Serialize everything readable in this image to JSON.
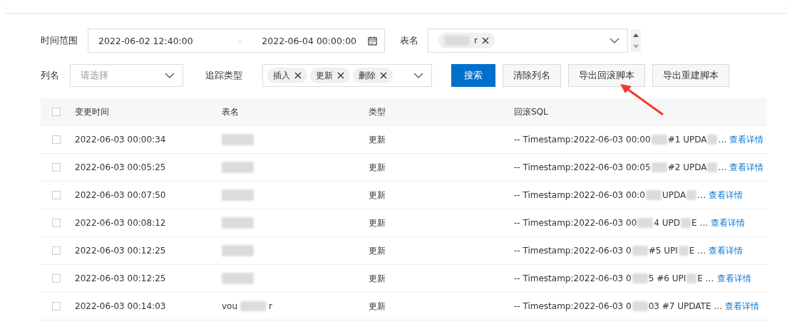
{
  "filters": {
    "time_range": {
      "label": "时间范围",
      "start": "2022-06-02 12:40:00",
      "separator": "-",
      "end": "2022-06-04 00:00:00"
    },
    "table_name": {
      "label": "表名",
      "tags": [
        {
          "text": "r"
        }
      ]
    },
    "column_name": {
      "label": "列名",
      "placeholder": "请选择"
    },
    "track_type": {
      "label": "追踪类型",
      "tags": [
        {
          "text": "插入"
        },
        {
          "text": "更新"
        },
        {
          "text": "删除"
        }
      ]
    }
  },
  "buttons": [
    {
      "label": "搜索",
      "kind": "primary"
    },
    {
      "label": "清除列名",
      "kind": "default"
    },
    {
      "label": "导出回滚脚本",
      "kind": "default"
    },
    {
      "label": "导出重建脚本",
      "kind": "default"
    }
  ],
  "table": {
    "columns": [
      "变更时间",
      "表名",
      "类型",
      "回滚SQL"
    ],
    "header_checked": false,
    "rows": [
      {
        "checked": false,
        "time": "2022-06-03 00:00:34",
        "table_parts": [],
        "type": "更新",
        "sql_parts": [
          "-- Timestamp:2022-06-03 00:00",
          "#1 UPDA",
          "…"
        ],
        "action": "查看详情"
      },
      {
        "checked": false,
        "time": "2022-06-03 00:05:25",
        "table_parts": [],
        "type": "更新",
        "sql_parts": [
          "-- Timestamp:2022-06-03 00:05",
          "#2 UPDA",
          "…"
        ],
        "action": "查看详情"
      },
      {
        "checked": false,
        "time": "2022-06-03 00:07:50",
        "table_parts": [],
        "type": "更新",
        "sql_parts": [
          "-- Timestamp:2022-06-03 00:0",
          "UPDA",
          "…"
        ],
        "action": "查看详情"
      },
      {
        "checked": false,
        "time": "2022-06-03 00:08:12",
        "table_parts": [],
        "type": "更新",
        "sql_parts": [
          "-- Timestamp:2022-06-03 00",
          "4 UPD",
          "E …"
        ],
        "action": "查看详情"
      },
      {
        "checked": false,
        "time": "2022-06-03 00:12:25",
        "table_parts": [],
        "type": "更新",
        "sql_parts": [
          "-- Timestamp:2022-06-03 0",
          "#5 UPI",
          "E …"
        ],
        "action": "查看详情"
      },
      {
        "checked": false,
        "time": "2022-06-03 00:12:25",
        "table_parts": [],
        "type": "更新",
        "sql_parts": [
          "-- Timestamp:2022-06-03 0",
          "5 #6 UPI",
          "E …"
        ],
        "action": "查看详情"
      },
      {
        "checked": false,
        "time": "2022-06-03 00:14:03",
        "table_parts": [
          "vou",
          "r"
        ],
        "type": "更新",
        "sql_parts": [
          "-- Timestamp:2022-06-03 0",
          "03 #7 UPDATE …"
        ],
        "action": "查看详情"
      }
    ]
  }
}
